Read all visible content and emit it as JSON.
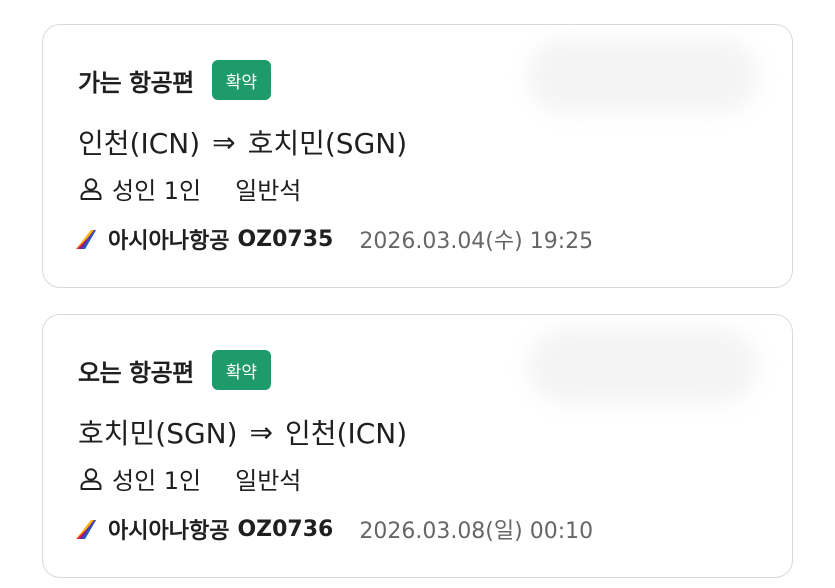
{
  "colors": {
    "badge_bg": "#1f9b6b",
    "badge_text": "#ffffff",
    "datetime_text": "#666666",
    "card_border": "#d9d9d9"
  },
  "flights": [
    {
      "title": "가는 항공편",
      "status": "확약",
      "origin": "인천(ICN)",
      "arrow": "⇒",
      "destination": "호치민(SGN)",
      "passengers": "성인 1인",
      "cabin": "일반석",
      "airline": "아시아나항공",
      "flight_no": "OZ0735",
      "datetime": "2026.03.04(수) 19:25",
      "icons": {
        "passenger": "person-icon",
        "airline": "airline-logo-icon"
      }
    },
    {
      "title": "오는 항공편",
      "status": "확약",
      "origin": "호치민(SGN)",
      "arrow": "⇒",
      "destination": "인천(ICN)",
      "passengers": "성인 1인",
      "cabin": "일반석",
      "airline": "아시아나항공",
      "flight_no": "OZ0736",
      "datetime": "2026.03.08(일) 00:10",
      "icons": {
        "passenger": "person-icon",
        "airline": "airline-logo-icon"
      }
    }
  ]
}
